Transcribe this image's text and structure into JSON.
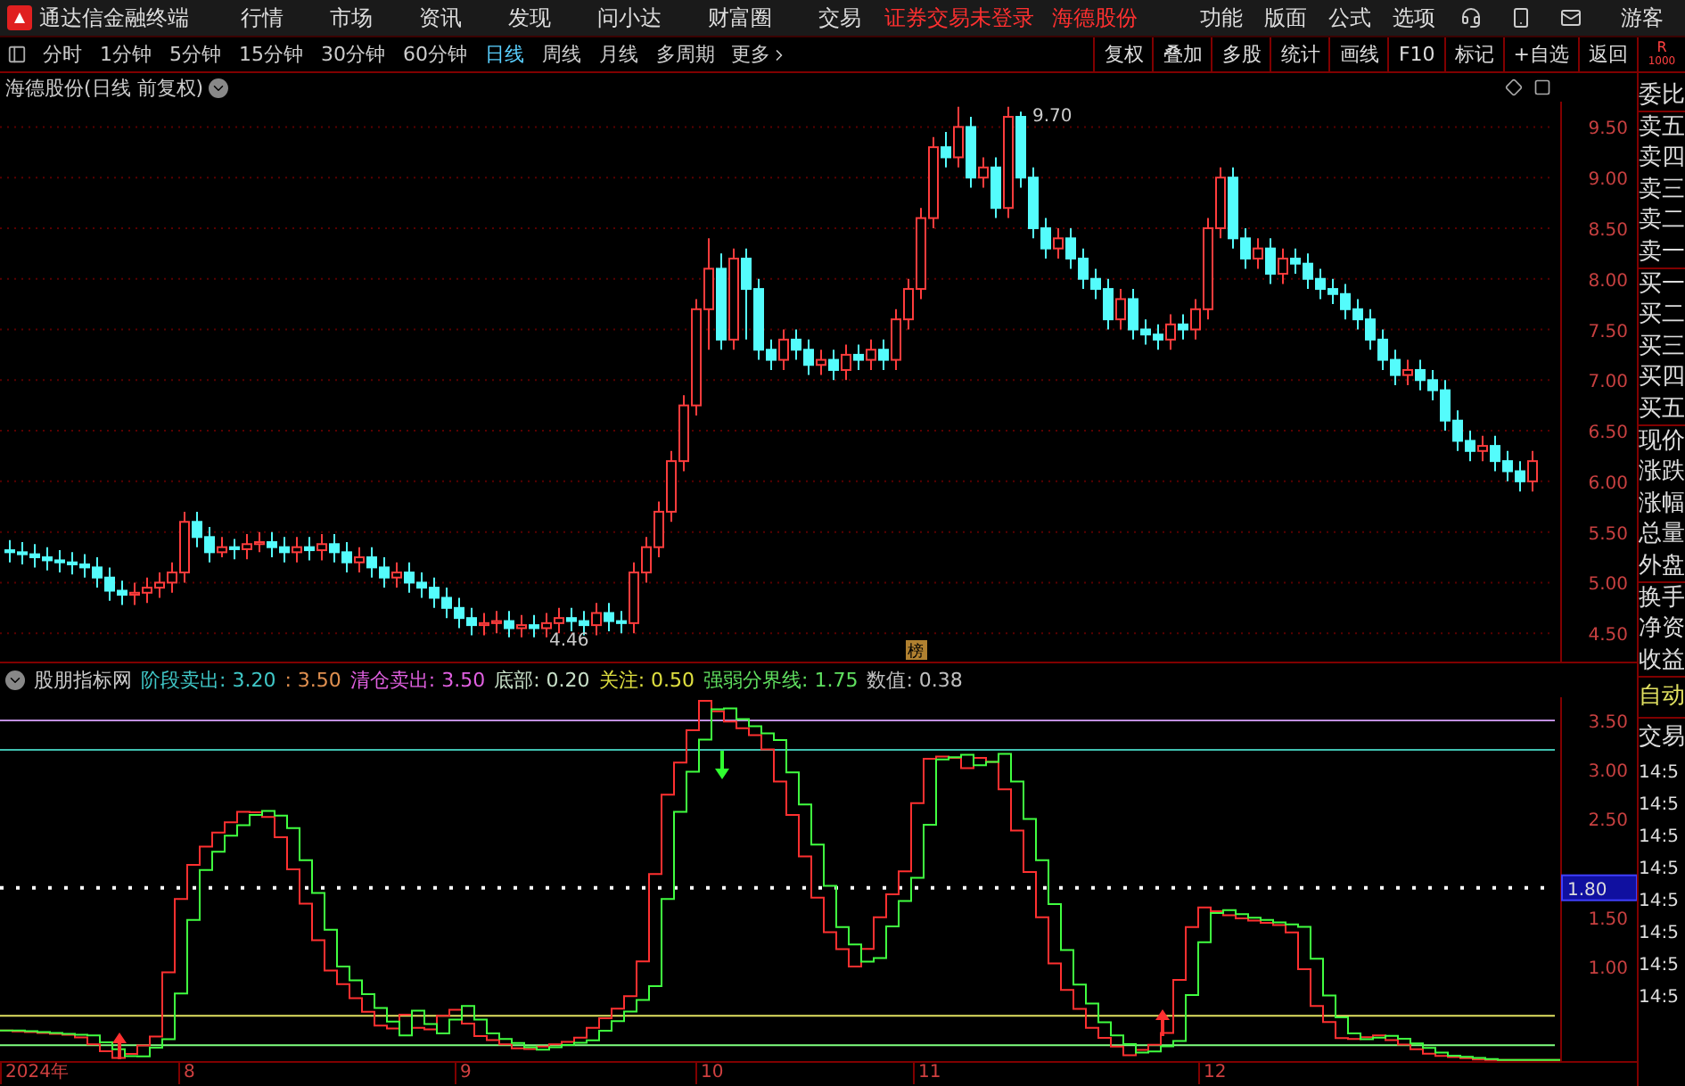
{
  "menu_bar": {
    "app_title": "通达信金融终端",
    "items": [
      "行情",
      "市场",
      "资讯",
      "发现",
      "问小达",
      "财富圈",
      "交易"
    ],
    "notices": [
      "证券交易未登录",
      "海德股份"
    ],
    "right_items": [
      "功能",
      "版面",
      "公式",
      "选项"
    ],
    "user": "游客"
  },
  "toolbar": {
    "periods": [
      {
        "label": "分时",
        "selected": false
      },
      {
        "label": "1分钟",
        "selected": false
      },
      {
        "label": "5分钟",
        "selected": false
      },
      {
        "label": "15分钟",
        "selected": false
      },
      {
        "label": "30分钟",
        "selected": false
      },
      {
        "label": "60分钟",
        "selected": false
      },
      {
        "label": "日线",
        "selected": true
      },
      {
        "label": "周线",
        "selected": false
      },
      {
        "label": "月线",
        "selected": false
      },
      {
        "label": "多周期",
        "selected": false
      }
    ],
    "more": "更多",
    "actions": [
      "复权",
      "叠加",
      "多股",
      "统计",
      "画线",
      "F10",
      "标记",
      "+自选",
      "返回"
    ],
    "corner": [
      "R",
      "1000"
    ]
  },
  "price_chart": {
    "title": "海德股份(日线 前复权)",
    "high_label": "9.70",
    "low_label": "4.46",
    "badge": "榜",
    "chart_data": {
      "type": "candlestick",
      "grid": true,
      "yticks": [
        {
          "value": 9.5,
          "label": "9.50"
        },
        {
          "value": 9,
          "label": "9.00"
        },
        {
          "value": 8.5,
          "label": "8.50"
        },
        {
          "value": 8,
          "label": "8.00"
        },
        {
          "value": 7.5,
          "label": "7.50"
        },
        {
          "value": 7,
          "label": "7.00"
        },
        {
          "value": 6.5,
          "label": "6.50"
        },
        {
          "value": 6,
          "label": "6.00"
        },
        {
          "value": 5.5,
          "label": "5.50"
        },
        {
          "value": 5,
          "label": "5.00"
        },
        {
          "value": 4.5,
          "label": "4.50"
        }
      ],
      "ylim": [
        4.22,
        9.75
      ],
      "ohlc": [
        [
          5.32,
          5.42,
          5.2,
          5.3
        ],
        [
          5.3,
          5.4,
          5.18,
          5.28
        ],
        [
          5.28,
          5.38,
          5.15,
          5.25
        ],
        [
          5.25,
          5.35,
          5.12,
          5.22
        ],
        [
          5.22,
          5.32,
          5.1,
          5.2
        ],
        [
          5.2,
          5.3,
          5.08,
          5.18
        ],
        [
          5.18,
          5.28,
          5.05,
          5.15
        ],
        [
          5.15,
          5.25,
          4.95,
          5.05
        ],
        [
          5.05,
          5.15,
          4.82,
          4.92
        ],
        [
          4.92,
          5.02,
          4.78,
          4.88
        ],
        [
          4.88,
          5.0,
          4.78,
          4.9
        ],
        [
          4.9,
          5.05,
          4.8,
          4.95
        ],
        [
          4.95,
          5.1,
          4.85,
          5.0
        ],
        [
          5.0,
          5.2,
          4.9,
          5.1
        ],
        [
          5.1,
          5.7,
          5.0,
          5.6
        ],
        [
          5.6,
          5.7,
          5.35,
          5.45
        ],
        [
          5.45,
          5.55,
          5.2,
          5.3
        ],
        [
          5.3,
          5.45,
          5.25,
          5.35
        ],
        [
          5.35,
          5.43,
          5.23,
          5.33
        ],
        [
          5.33,
          5.48,
          5.23,
          5.38
        ],
        [
          5.38,
          5.5,
          5.3,
          5.4
        ],
        [
          5.4,
          5.5,
          5.25,
          5.35
        ],
        [
          5.35,
          5.45,
          5.2,
          5.3
        ],
        [
          5.3,
          5.45,
          5.2,
          5.35
        ],
        [
          5.35,
          5.45,
          5.22,
          5.32
        ],
        [
          5.32,
          5.48,
          5.22,
          5.38
        ],
        [
          5.38,
          5.48,
          5.2,
          5.3
        ],
        [
          5.3,
          5.4,
          5.1,
          5.2
        ],
        [
          5.2,
          5.35,
          5.1,
          5.25
        ],
        [
          5.25,
          5.35,
          5.05,
          5.15
        ],
        [
          5.15,
          5.25,
          4.95,
          5.05
        ],
        [
          5.05,
          5.2,
          4.95,
          5.1
        ],
        [
          5.1,
          5.2,
          4.9,
          5.0
        ],
        [
          5.0,
          5.1,
          4.85,
          4.95
        ],
        [
          4.95,
          5.05,
          4.75,
          4.85
        ],
        [
          4.85,
          4.95,
          4.65,
          4.75
        ],
        [
          4.75,
          4.85,
          4.55,
          4.65
        ],
        [
          4.65,
          4.75,
          4.48,
          4.58
        ],
        [
          4.58,
          4.7,
          4.48,
          4.6
        ],
        [
          4.6,
          4.72,
          4.5,
          4.62
        ],
        [
          4.62,
          4.72,
          4.46,
          4.55
        ],
        [
          4.55,
          4.68,
          4.46,
          4.58
        ],
        [
          4.58,
          4.68,
          4.46,
          4.55
        ],
        [
          4.55,
          4.7,
          4.46,
          4.6
        ],
        [
          4.6,
          4.75,
          4.5,
          4.65
        ],
        [
          4.65,
          4.75,
          4.52,
          4.62
        ],
        [
          4.62,
          4.72,
          4.48,
          4.58
        ],
        [
          4.58,
          4.8,
          4.48,
          4.7
        ],
        [
          4.7,
          4.8,
          4.52,
          4.62
        ],
        [
          4.62,
          4.72,
          4.5,
          4.6
        ],
        [
          4.6,
          5.2,
          4.5,
          5.1
        ],
        [
          5.1,
          5.45,
          5.0,
          5.35
        ],
        [
          5.35,
          5.8,
          5.25,
          5.7
        ],
        [
          5.7,
          6.3,
          5.6,
          6.2
        ],
        [
          6.2,
          6.85,
          6.1,
          6.75
        ],
        [
          6.75,
          7.8,
          6.65,
          7.7
        ],
        [
          7.7,
          8.4,
          7.3,
          8.1
        ],
        [
          8.1,
          8.25,
          7.3,
          7.4
        ],
        [
          7.4,
          8.3,
          7.3,
          8.2
        ],
        [
          8.2,
          8.3,
          7.4,
          7.9
        ],
        [
          7.9,
          8.0,
          7.2,
          7.3
        ],
        [
          7.3,
          7.4,
          7.1,
          7.2
        ],
        [
          7.2,
          7.5,
          7.1,
          7.4
        ],
        [
          7.4,
          7.5,
          7.2,
          7.3
        ],
        [
          7.3,
          7.4,
          7.05,
          7.15
        ],
        [
          7.15,
          7.3,
          7.05,
          7.2
        ],
        [
          7.2,
          7.3,
          7.0,
          7.1
        ],
        [
          7.1,
          7.35,
          7.0,
          7.25
        ],
        [
          7.25,
          7.35,
          7.1,
          7.2
        ],
        [
          7.2,
          7.4,
          7.1,
          7.3
        ],
        [
          7.3,
          7.4,
          7.1,
          7.2
        ],
        [
          7.2,
          7.7,
          7.1,
          7.6
        ],
        [
          7.6,
          8.0,
          7.5,
          7.9
        ],
        [
          7.9,
          8.7,
          7.8,
          8.6
        ],
        [
          8.6,
          9.4,
          8.5,
          9.3
        ],
        [
          9.3,
          9.45,
          9.1,
          9.2
        ],
        [
          9.2,
          9.7,
          9.1,
          9.5
        ],
        [
          9.5,
          9.6,
          8.9,
          9.0
        ],
        [
          9.0,
          9.2,
          8.9,
          9.1
        ],
        [
          9.1,
          9.2,
          8.6,
          8.7
        ],
        [
          8.7,
          9.7,
          8.6,
          9.6
        ],
        [
          9.6,
          9.65,
          8.9,
          9.0
        ],
        [
          9.0,
          9.1,
          8.4,
          8.5
        ],
        [
          8.5,
          8.6,
          8.2,
          8.3
        ],
        [
          8.3,
          8.5,
          8.2,
          8.4
        ],
        [
          8.4,
          8.5,
          8.1,
          8.2
        ],
        [
          8.2,
          8.3,
          7.9,
          8.0
        ],
        [
          8.0,
          8.1,
          7.8,
          7.9
        ],
        [
          7.9,
          8.0,
          7.5,
          7.6
        ],
        [
          7.6,
          7.9,
          7.5,
          7.8
        ],
        [
          7.8,
          7.9,
          7.4,
          7.5
        ],
        [
          7.5,
          7.6,
          7.35,
          7.45
        ],
        [
          7.45,
          7.55,
          7.3,
          7.4
        ],
        [
          7.4,
          7.65,
          7.3,
          7.55
        ],
        [
          7.55,
          7.65,
          7.4,
          7.5
        ],
        [
          7.5,
          7.8,
          7.4,
          7.7
        ],
        [
          7.7,
          8.6,
          7.6,
          8.5
        ],
        [
          8.5,
          9.1,
          8.4,
          9.0
        ],
        [
          9.0,
          9.1,
          8.3,
          8.4
        ],
        [
          8.4,
          8.5,
          8.1,
          8.2
        ],
        [
          8.2,
          8.4,
          8.1,
          8.3
        ],
        [
          8.3,
          8.4,
          7.95,
          8.05
        ],
        [
          8.05,
          8.3,
          7.95,
          8.2
        ],
        [
          8.2,
          8.3,
          8.05,
          8.15
        ],
        [
          8.15,
          8.25,
          7.9,
          8.0
        ],
        [
          8.0,
          8.1,
          7.8,
          7.9
        ],
        [
          7.9,
          8.0,
          7.75,
          7.85
        ],
        [
          7.85,
          7.95,
          7.6,
          7.7
        ],
        [
          7.7,
          7.8,
          7.5,
          7.6
        ],
        [
          7.6,
          7.7,
          7.3,
          7.4
        ],
        [
          7.4,
          7.5,
          7.1,
          7.2
        ],
        [
          7.2,
          7.3,
          6.95,
          7.05
        ],
        [
          7.05,
          7.2,
          6.95,
          7.1
        ],
        [
          7.1,
          7.2,
          6.9,
          7.0
        ],
        [
          7.0,
          7.1,
          6.8,
          6.9
        ],
        [
          6.9,
          7.0,
          6.5,
          6.6
        ],
        [
          6.6,
          6.7,
          6.3,
          6.4
        ],
        [
          6.4,
          6.5,
          6.2,
          6.3
        ],
        [
          6.3,
          6.45,
          6.2,
          6.35
        ],
        [
          6.35,
          6.45,
          6.1,
          6.2
        ],
        [
          6.2,
          6.3,
          6.0,
          6.1
        ],
        [
          6.1,
          6.2,
          5.9,
          6.0
        ],
        [
          6.0,
          6.3,
          5.9,
          6.2
        ]
      ]
    }
  },
  "indicator": {
    "name": "股朋指标网",
    "readings": [
      {
        "text": "阶段卖出: 3.20",
        "color": "#40c8c8"
      },
      {
        "text": ": 3.50",
        "color": "#e09050"
      },
      {
        "text": "清仓卖出: 3.50",
        "color": "#e060e0"
      },
      {
        "text": "底部: 0.20",
        "color": "#c8e0c8"
      },
      {
        "text": "关注: 0.50",
        "color": "#e0e040"
      },
      {
        "text": "强弱分界线: 1.75",
        "color": "#60e060"
      },
      {
        "text": "数值: 0.38",
        "color": "#c0c0c0"
      }
    ],
    "y_ticks": [
      "3.50",
      "3.00",
      "2.50",
      "1.50",
      "1.00"
    ],
    "current": "1.80"
  },
  "date_axis": [
    "2024年",
    "8",
    "9",
    "10",
    "11",
    "12"
  ],
  "side_panel": {
    "quote_labels": [
      "委比",
      "卖五",
      "卖四",
      "卖三",
      "卖二",
      "卖一",
      "买一",
      "买二",
      "买三",
      "买四",
      "买五",
      "现价",
      "涨跌",
      "涨幅",
      "总量",
      "外盘",
      "换手",
      "净资",
      "收益"
    ],
    "trade_labels": [
      {
        "text": "自动",
        "kind": "mode"
      },
      {
        "text": "交易",
        "kind": "plain"
      }
    ],
    "times": [
      "14:5",
      "14:5",
      "14:5",
      "14:5",
      "14:5",
      "14:5",
      "14:5",
      "14:5"
    ]
  }
}
